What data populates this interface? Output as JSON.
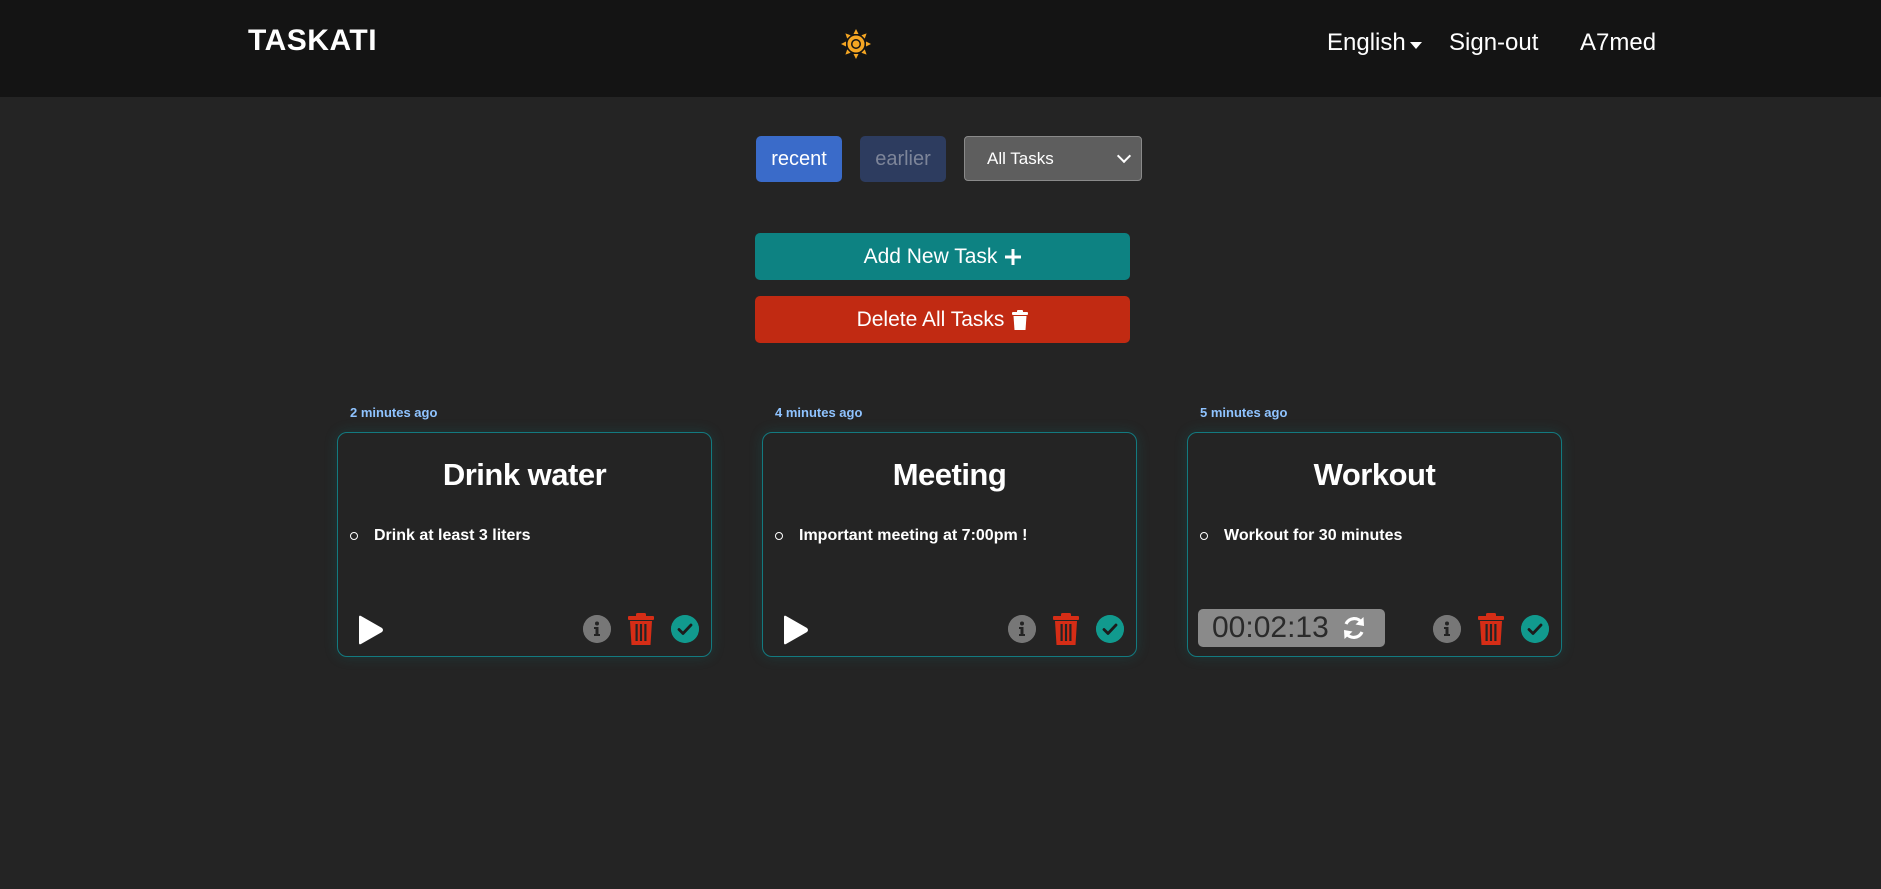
{
  "header": {
    "brand": "TASKATI",
    "language": "English",
    "signout": "Sign-out",
    "username": "A7med",
    "theme_icon": "sun-icon",
    "accent_color": "#f5a623"
  },
  "filters": {
    "recent_label": "recent",
    "earlier_label": "earlier",
    "select_value": "All Tasks",
    "recent_color": "#3a6bc9"
  },
  "actions": {
    "add_label": "Add New Task",
    "delete_all_label": "Delete All Tasks",
    "add_color": "#0d8282",
    "delete_color": "#c12a12"
  },
  "tasks": [
    {
      "time_ago": "2 minutes ago",
      "title": "Drink water",
      "item": "Drink at least 3 liters",
      "timer": null
    },
    {
      "time_ago": "4 minutes ago",
      "title": "Meeting",
      "item": "Important meeting at 7:00pm !",
      "timer": null
    },
    {
      "time_ago": "5 minutes ago",
      "title": "Workout",
      "item": "Workout for 30 minutes",
      "timer": "00:02:13"
    }
  ]
}
